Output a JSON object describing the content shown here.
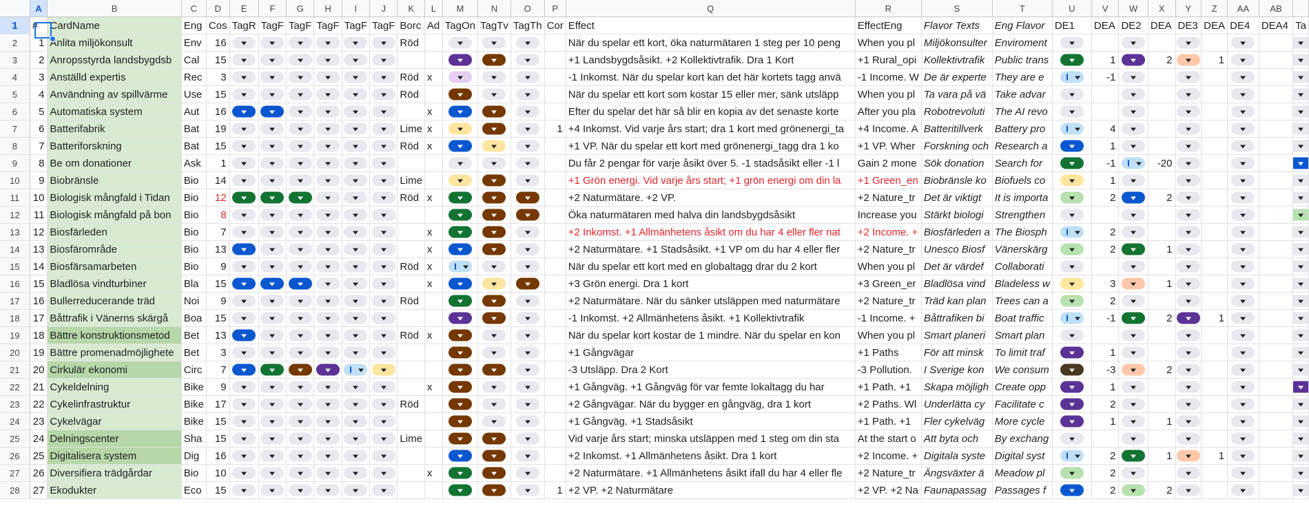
{
  "colors": {
    "darkGreen": "#137333",
    "lightGreen": "#b7e1b0",
    "blue": "#0b57d0",
    "lightBlue": "#bfe0f6",
    "purple": "#5b3296",
    "brown": "#753800",
    "yellow": "#ffe5a0",
    "lightPurple": "#e6cff2",
    "salmon": "#ffc8aa",
    "gray": "#e7e9ee",
    "darkBrown": "#473822"
  },
  "columns": [
    "A",
    "B",
    "C",
    "D",
    "E",
    "F",
    "G",
    "H",
    "I",
    "J",
    "K",
    "L",
    "M",
    "N",
    "O",
    "P",
    "Q",
    "R",
    "S",
    "T",
    "U",
    "V",
    "W",
    "X",
    "Y",
    "Z",
    "AA",
    "AB",
    ""
  ],
  "header": [
    "#",
    "CardName",
    "Eng",
    "Cos",
    "TagR",
    "TagF",
    "TagF",
    "TagF",
    "TagF",
    "TagF",
    "Borc",
    "Ad",
    "TagOn",
    "TagTv",
    "TagTh",
    "Cor",
    "Effect",
    "EffectEng",
    "Flavor Texts",
    "Eng Flavor",
    "DE1",
    "DEA",
    "DE2",
    "DEA",
    "DE3",
    "DEA",
    "DE4",
    "DEA4",
    "Ta"
  ],
  "rows": [
    {
      "n": "2",
      "a": "1",
      "b": "Anlita miljökonsult",
      "c": "Env",
      "d": "16",
      "e": "",
      "f": "",
      "g": "",
      "h": "",
      "i": "",
      "j": "",
      "k": "Röd",
      "l": "",
      "m": "",
      "nn": "",
      "o": "",
      "p": "",
      "q": "När du spelar ett kort, öka naturmätaren 1 steg per 10 peng",
      "r": "When you pl",
      "s": "Miljökonsulter",
      "t": "Enviroment",
      "u": "",
      "v": "",
      "w": "",
      "x": "",
      "y": "",
      "z": "",
      "aa": "",
      "ab": "",
      "ac": ""
    },
    {
      "n": "3",
      "a": "2",
      "b": "Anropsstyrda landsbygdsb",
      "c": "Cal",
      "d": "15",
      "e": "",
      "f": "",
      "g": "",
      "h": "",
      "i": "",
      "j": "",
      "k": "",
      "l": "",
      "m": "purple",
      "nn": "brown",
      "o": "",
      "p": "",
      "q": "+1 Landsbygdsåsikt. +2 Kollektivtrafik. Dra 1 Kort",
      "r": "+1 Rural_opi",
      "s": "Kollektivtrafik",
      "t": "Public trans",
      "u": "darkGreen",
      "v": "1",
      "w": "purple",
      "x": "2",
      "y": "salmon",
      "z": "1",
      "aa": "",
      "ab": "",
      "ac": ""
    },
    {
      "n": "4",
      "a": "3",
      "b": "Anställd expertis",
      "c": "Rec",
      "d": "3",
      "e": "",
      "f": "",
      "g": "",
      "h": "",
      "i": "",
      "j": "",
      "k": "Röd",
      "l": "x",
      "m": "lightPurple",
      "nn": "",
      "o": "",
      "p": "",
      "q": "-1 Inkomst. När du spelar kort kan det här kortets tagg anvä",
      "r": "-1 Income. W",
      "s": "De är experte",
      "t": "They are e",
      "u": "lightBlue",
      "v": "-1",
      "w": "",
      "x": "",
      "y": "",
      "z": "",
      "aa": "",
      "ab": "",
      "ac": ""
    },
    {
      "n": "5",
      "a": "4",
      "b": "Användning av spillvärme",
      "c": "Use",
      "d": "15",
      "e": "",
      "f": "",
      "g": "",
      "h": "",
      "i": "",
      "j": "",
      "k": "Röd",
      "l": "",
      "m": "brown",
      "nn": "",
      "o": "",
      "p": "",
      "q": "När du spelar ett kort som kostar 15 eller mer, sänk utsläpp",
      "r": "When you pl",
      "s": "Ta vara på vä",
      "t": "Take advar",
      "u": "",
      "v": "",
      "w": "",
      "x": "",
      "y": "",
      "z": "",
      "aa": "",
      "ab": "",
      "ac": ""
    },
    {
      "n": "6",
      "a": "5",
      "b": "Automatiska system",
      "c": "Aut",
      "d": "16",
      "e": "blue",
      "f": "blue",
      "g": "",
      "h": "",
      "i": "",
      "j": "",
      "k": "",
      "l": "x",
      "m": "blue",
      "nn": "brown",
      "o": "",
      "p": "",
      "q": "Efter du spelar det här så blir en kopia av det senaste korte",
      "r": "After you pla",
      "s": "Robotrevoluti",
      "t": "The AI revo",
      "u": "",
      "v": "",
      "w": "",
      "x": "",
      "y": "",
      "z": "",
      "aa": "",
      "ab": "",
      "ac": ""
    },
    {
      "n": "7",
      "a": "6",
      "b": "Batterifabrik",
      "c": "Bat",
      "d": "19",
      "e": "",
      "f": "",
      "g": "",
      "h": "",
      "i": "",
      "j": "",
      "k": "Lime",
      "l": "x",
      "m": "yellow",
      "nn": "brown",
      "o": "",
      "p": "1",
      "q": "+4 Inkomst. Vid varje års start; dra 1 kort med grönenergi_ta",
      "r": "+4 Income. A",
      "s": "Batteritillverk",
      "t": "Battery pro",
      "u": "lightBlue",
      "v": "4",
      "w": "",
      "x": "",
      "y": "",
      "z": "",
      "aa": "",
      "ab": "",
      "ac": ""
    },
    {
      "n": "8",
      "a": "7",
      "b": "Batteriforskning",
      "c": "Bat",
      "d": "15",
      "e": "",
      "f": "",
      "g": "",
      "h": "",
      "i": "",
      "j": "",
      "k": "Röd",
      "l": "x",
      "m": "blue",
      "nn": "yellow",
      "o": "",
      "p": "",
      "q": "+1 VP. När du spelar ett kort med grönenergi_tagg dra 1 ko",
      "r": "+1 VP. Wher",
      "s": "Forskning och",
      "t": "Research a",
      "u": "blue",
      "v": "1",
      "w": "",
      "x": "",
      "y": "",
      "z": "",
      "aa": "",
      "ab": "",
      "ac": ""
    },
    {
      "n": "9",
      "a": "8",
      "b": "Be om donationer",
      "c": "Ask",
      "d": "1",
      "e": "",
      "f": "",
      "g": "",
      "h": "",
      "i": "",
      "j": "",
      "k": "",
      "l": "",
      "m": "",
      "nn": "",
      "o": "",
      "p": "",
      "q": "Du får 2 pengar för varje åsikt över 5. -1 stadsåsikt eller -1 l",
      "r": "Gain 2 mone",
      "s": "Sök donation",
      "t": "Search for",
      "u": "darkGreen",
      "v": "-1",
      "w": "lightBlue",
      "x": "-20",
      "y": "",
      "z": "",
      "aa": "",
      "ab": "",
      "ac": "blue"
    },
    {
      "n": "10",
      "a": "9",
      "b": "Biobränsle",
      "c": "Bio",
      "d": "14",
      "e": "",
      "f": "",
      "g": "",
      "h": "",
      "i": "",
      "j": "",
      "k": "Lime",
      "l": "",
      "m": "yellow",
      "nn": "brown",
      "o": "",
      "p": "",
      "q": "+1 Grön energi. Vid varje års start; +1 grön energi om din la",
      "r": "+1 Green_en",
      "s": "Biobränsle ko",
      "t": "Biofuels co",
      "u": "yellow",
      "v": "1",
      "w": "",
      "x": "",
      "y": "",
      "z": "",
      "aa": "",
      "ab": "",
      "ac": "",
      "red": true
    },
    {
      "n": "11",
      "a": "10",
      "b": "Biologisk mångfald i Tidan",
      "c": "Bio",
      "d": "12",
      "e": "darkGreen",
      "f": "darkGreen",
      "g": "darkGreen",
      "h": "",
      "i": "",
      "j": "",
      "k": "Röd",
      "l": "x",
      "m": "darkGreen",
      "nn": "brown",
      "o": "brown",
      "p": "",
      "q": "+2 Naturmätare. +2 VP.",
      "r": "+2 Nature_tr",
      "s": "Det är viktigt",
      "t": "It is importa",
      "u": "lightGreen",
      "v": "2",
      "w": "blue",
      "x": "2",
      "y": "",
      "z": "",
      "aa": "",
      "ab": "",
      "ac": "",
      "redCost": true
    },
    {
      "n": "12",
      "a": "11",
      "b": "Biologisk mångfald på bon",
      "c": "Bio",
      "d": "8",
      "e": "",
      "f": "",
      "g": "",
      "h": "",
      "i": "",
      "j": "",
      "k": "",
      "l": "",
      "m": "darkGreen",
      "nn": "brown",
      "o": "brown",
      "p": "",
      "q": "Öka naturmätaren med halva din landsbygdsåsikt",
      "r": "Increase you",
      "s": "Stärkt biologi",
      "t": "Strengthen",
      "u": "",
      "v": "",
      "w": "",
      "x": "",
      "y": "",
      "z": "",
      "aa": "",
      "ab": "",
      "ac": "lightGreen",
      "redCost": true
    },
    {
      "n": "13",
      "a": "12",
      "b": "Biosfärleden",
      "c": "Bio",
      "d": "7",
      "e": "",
      "f": "",
      "g": "",
      "h": "",
      "i": "",
      "j": "",
      "k": "",
      "l": "x",
      "m": "darkGreen",
      "nn": "brown",
      "o": "",
      "p": "",
      "q": "+2 Inkomst. +1 Allmänhetens åsikt om du har 4 eller fler nat",
      "r": "+2 Income. +",
      "s": "Biosfärleden a",
      "t": "The Biosph",
      "u": "lightBlue",
      "v": "2",
      "w": "",
      "x": "",
      "y": "",
      "z": "",
      "aa": "",
      "ab": "",
      "ac": "",
      "red": true
    },
    {
      "n": "14",
      "a": "13",
      "b": "Biosfärområde",
      "c": "Bio",
      "d": "13",
      "e": "blue",
      "f": "",
      "g": "",
      "h": "",
      "i": "",
      "j": "",
      "k": "",
      "l": "x",
      "m": "blue",
      "nn": "brown",
      "o": "",
      "p": "",
      "q": "+2 Naturmätare. +1 Stadsåsikt. +1 VP om du har 4 eller fler",
      "r": "+2 Nature_tr",
      "s": "Unesco Biosf",
      "t": "Vänerskärg",
      "u": "lightGreen",
      "v": "2",
      "w": "darkGreen",
      "x": "1",
      "y": "",
      "z": "",
      "aa": "",
      "ab": "",
      "ac": ""
    },
    {
      "n": "15",
      "a": "14",
      "b": "Biosfärsamarbeten",
      "c": "Bio",
      "d": "9",
      "e": "",
      "f": "",
      "g": "",
      "h": "",
      "i": "",
      "j": "",
      "k": "Röd",
      "l": "x",
      "m": "lightBlue",
      "nn": "",
      "o": "",
      "p": "",
      "q": "När du spelar ett kort med en globaltagg drar du 2 kort",
      "r": "When you pl",
      "s": "Det är värdef",
      "t": "Collaborati",
      "u": "",
      "v": "",
      "w": "",
      "x": "",
      "y": "",
      "z": "",
      "aa": "",
      "ab": "",
      "ac": ""
    },
    {
      "n": "16",
      "a": "15",
      "b": "Bladlösa vindturbiner",
      "c": "Bla",
      "d": "15",
      "e": "blue",
      "f": "blue",
      "g": "blue",
      "h": "",
      "i": "",
      "j": "",
      "k": "",
      "l": "x",
      "m": "blue",
      "nn": "yellow",
      "o": "brown",
      "p": "",
      "q": "+3 Grön energi. Dra 1 kort",
      "r": "+3 Green_er",
      "s": "Bladlösa vind",
      "t": "Bladeless w",
      "u": "yellow",
      "v": "3",
      "w": "salmon",
      "x": "1",
      "y": "",
      "z": "",
      "aa": "",
      "ab": "",
      "ac": ""
    },
    {
      "n": "17",
      "a": "16",
      "b": "Bullerreducerande träd",
      "c": "Noi",
      "d": "9",
      "e": "",
      "f": "",
      "g": "",
      "h": "",
      "i": "",
      "j": "",
      "k": "Röd",
      "l": "",
      "m": "darkGreen",
      "nn": "brown",
      "o": "",
      "p": "",
      "q": "+2 Naturmätare. När du sänker utsläppen med naturmätare",
      "r": "+2 Nature_tr",
      "s": "Träd kan plan",
      "t": "Trees can a",
      "u": "lightGreen",
      "v": "2",
      "w": "",
      "x": "",
      "y": "",
      "z": "",
      "aa": "",
      "ab": "",
      "ac": ""
    },
    {
      "n": "18",
      "a": "17",
      "b": "Båttrafik i Vänerns skärgå",
      "c": "Boa",
      "d": "15",
      "e": "",
      "f": "",
      "g": "",
      "h": "",
      "i": "",
      "j": "",
      "k": "",
      "l": "",
      "m": "purple",
      "nn": "brown",
      "o": "",
      "p": "",
      "q": "-1 Inkomst. +2 Allmänhetens åsikt. +1 Kollektivtrafik",
      "r": "-1 Income. +",
      "s": "Båttrafiken bi",
      "t": "Boat traffic",
      "u": "lightBlue",
      "v": "-1",
      "w": "darkGreen",
      "x": "2",
      "y": "purple",
      "z": "1",
      "aa": "",
      "ab": "",
      "ac": ""
    },
    {
      "n": "19",
      "a": "18",
      "b": "Bättre konstruktionsmetod",
      "c": "Bet",
      "d": "13",
      "e": "blue",
      "f": "",
      "g": "",
      "h": "",
      "i": "",
      "j": "",
      "k": "Röd",
      "l": "x",
      "m": "brown",
      "nn": "",
      "o": "",
      "p": "",
      "q": "När du spelar kort kostar de 1 mindre. När du spelar en kon",
      "r": "When you pl",
      "s": "Smart planeri",
      "t": "Smart plan",
      "u": "",
      "v": "",
      "w": "",
      "x": "",
      "y": "",
      "z": "",
      "aa": "",
      "ab": "",
      "ac": "",
      "greenDk": true
    },
    {
      "n": "20",
      "a": "19",
      "b": "Bättre promenadmöjlighete",
      "c": "Bet",
      "d": "3",
      "e": "",
      "f": "",
      "g": "",
      "h": "",
      "i": "",
      "j": "",
      "k": "",
      "l": "",
      "m": "brown",
      "nn": "",
      "o": "",
      "p": "",
      "q": "+1 Gångvägar",
      "r": "+1 Paths",
      "s": "För att minsk",
      "t": "To limit traf",
      "u": "purple",
      "v": "1",
      "w": "",
      "x": "",
      "y": "",
      "z": "",
      "aa": "",
      "ab": "",
      "ac": ""
    },
    {
      "n": "21",
      "a": "20",
      "b": "Cirkulär ekonomi",
      "c": "Circ",
      "d": "7",
      "e": "blue",
      "f": "darkGreen",
      "g": "brown",
      "h": "purple",
      "i": "lightBlue",
      "j": "yellow",
      "k": "",
      "l": "",
      "m": "brown",
      "nn": "brown",
      "o": "",
      "p": "",
      "q": "-3 Utsläpp. Dra 2 Kort",
      "r": "-3 Pollution.",
      "s": "I Sverige kon",
      "t": "We consum",
      "u": "darkBrown",
      "v": "-3",
      "w": "salmon",
      "x": "2",
      "y": "",
      "z": "",
      "aa": "",
      "ab": "",
      "ac": "",
      "greenDk": true
    },
    {
      "n": "22",
      "a": "21",
      "b": "Cykeldelning",
      "c": "Bike",
      "d": "9",
      "e": "",
      "f": "",
      "g": "",
      "h": "",
      "i": "",
      "j": "",
      "k": "",
      "l": "x",
      "m": "brown",
      "nn": "",
      "o": "",
      "p": "",
      "q": "+1 Gångväg. +1 Gångväg för var femte lokaltagg du har",
      "r": "+1 Path. +1",
      "s": "Skapa möjligh",
      "t": "Create opp",
      "u": "purple",
      "v": "1",
      "w": "",
      "x": "",
      "y": "",
      "z": "",
      "aa": "",
      "ab": "",
      "ac": "purple"
    },
    {
      "n": "23",
      "a": "22",
      "b": "Cykelinfrastruktur",
      "c": "Bike",
      "d": "17",
      "e": "",
      "f": "",
      "g": "",
      "h": "",
      "i": "",
      "j": "",
      "k": "Röd",
      "l": "",
      "m": "brown",
      "nn": "",
      "o": "",
      "p": "",
      "q": "+2 Gångvägar. När du bygger en gångväg, dra 1 kort",
      "r": "+2 Paths. Wl",
      "s": "Underlätta cy",
      "t": "Facilitate c",
      "u": "purple",
      "v": "2",
      "w": "",
      "x": "",
      "y": "",
      "z": "",
      "aa": "",
      "ab": "",
      "ac": ""
    },
    {
      "n": "24",
      "a": "23",
      "b": "Cykelvägar",
      "c": "Bike",
      "d": "15",
      "e": "",
      "f": "",
      "g": "",
      "h": "",
      "i": "",
      "j": "",
      "k": "",
      "l": "",
      "m": "brown",
      "nn": "",
      "o": "",
      "p": "",
      "q": "+1 Gångväg. +1 Stadsåsikt",
      "r": "+1 Path. +1",
      "s": "Fler cykelväg",
      "t": "More cycle",
      "u": "purple",
      "v": "1",
      "w": "",
      "x": "1",
      "y": "",
      "z": "",
      "aa": "",
      "ab": "",
      "ac": ""
    },
    {
      "n": "25",
      "a": "24",
      "b": "Delningscenter",
      "c": "Sha",
      "d": "15",
      "e": "",
      "f": "",
      "g": "",
      "h": "",
      "i": "",
      "j": "",
      "k": "Lime",
      "l": "",
      "m": "brown",
      "nn": "brown",
      "o": "",
      "p": "",
      "q": "Vid varje års start; minska utsläppen med  1 steg om din sta",
      "r": "At the start o",
      "s": "Att byta och",
      "t": "By exchang",
      "u": "",
      "v": "",
      "w": "",
      "x": "",
      "y": "",
      "z": "",
      "aa": "",
      "ab": "",
      "ac": "",
      "greenDk": true
    },
    {
      "n": "26",
      "a": "25",
      "b": "Digitalisera system",
      "c": "Dig",
      "d": "16",
      "e": "",
      "f": "",
      "g": "",
      "h": "",
      "i": "",
      "j": "",
      "k": "",
      "l": "",
      "m": "blue",
      "nn": "brown",
      "o": "",
      "p": "",
      "q": "+2 Inkomst. +1 Allmänhetens åsikt. Dra 1 kort",
      "r": "+2 Income. +",
      "s": "Digitala syste",
      "t": "Digital syst",
      "u": "lightBlue",
      "v": "2",
      "w": "darkGreen",
      "x": "1",
      "y": "salmon",
      "z": "1",
      "aa": "",
      "ab": "",
      "ac": "",
      "greenDk": true
    },
    {
      "n": "27",
      "a": "26",
      "b": "Diversifiera trädgårdar",
      "c": "Bio",
      "d": "10",
      "e": "",
      "f": "",
      "g": "",
      "h": "",
      "i": "",
      "j": "",
      "k": "",
      "l": "x",
      "m": "darkGreen",
      "nn": "brown",
      "o": "",
      "p": "",
      "q": "+2 Naturmätare. +1 Allmänhetens åsikt ifall du har 4 eller fle",
      "r": "+2 Nature_tr",
      "s": "Ängsväxter ä",
      "t": "Meadow pl",
      "u": "lightGreen",
      "v": "2",
      "w": "",
      "x": "",
      "y": "",
      "z": "",
      "aa": "",
      "ab": "",
      "ac": ""
    },
    {
      "n": "28",
      "a": "27",
      "b": "Ekodukter",
      "c": "Eco",
      "d": "15",
      "e": "",
      "f": "",
      "g": "",
      "h": "",
      "i": "",
      "j": "",
      "k": "",
      "l": "",
      "m": "darkGreen",
      "nn": "brown",
      "o": "",
      "p": "1",
      "q": "+2 VP. +2 Naturmätare",
      "r": "+2 VP. +2 Na",
      "s": "Faunapassag",
      "t": "Passages f",
      "u": "blue",
      "v": "2",
      "w": "lightGreen",
      "x": "2",
      "y": "",
      "z": "",
      "aa": "",
      "ab": "",
      "ac": ""
    }
  ]
}
